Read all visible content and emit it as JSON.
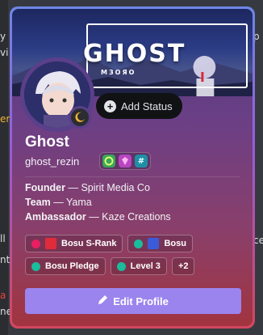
{
  "background": {
    "left_fragments": [
      "y",
      "vi",
      "er",
      "ll",
      "nt",
      "a",
      "ne"
    ],
    "right_fragments": [
      "p",
      "ce"
    ]
  },
  "banner": {
    "title": "GHOST",
    "subtitle": "МЗОЯО"
  },
  "profile": {
    "display_name": "Ghost",
    "username": "ghost_rezin",
    "status_button": "Add Status",
    "badge_icons": [
      "nitro-icon",
      "gem-icon",
      "hashtag-icon"
    ]
  },
  "bio": {
    "lines": [
      {
        "label": "Founder",
        "text": " — Spirit Media Co"
      },
      {
        "label": "Team",
        "text": " — Yama"
      },
      {
        "label": "Ambassador",
        "text": " — Kaze Creations"
      }
    ]
  },
  "roles": [
    {
      "label": "Bosu S-Rank",
      "color": "#e91e63",
      "icon": true,
      "icon_color": "#e02b3a"
    },
    {
      "label": "Bosu",
      "color": "#1abc9c",
      "icon": true,
      "icon_color": "#3b5bd9"
    },
    {
      "label": "Bosu Pledge",
      "color": "#1abc9c",
      "icon": false
    },
    {
      "label": "Level 3",
      "color": "#1abc9c",
      "icon": false
    },
    {
      "label": "+2",
      "color": null,
      "icon": false
    }
  ],
  "actions": {
    "edit_profile": "Edit Profile"
  },
  "colors": {
    "accent": "#9b84ee",
    "card_border_top": "#6e86e6",
    "card_border_bottom": "#d2475e"
  }
}
